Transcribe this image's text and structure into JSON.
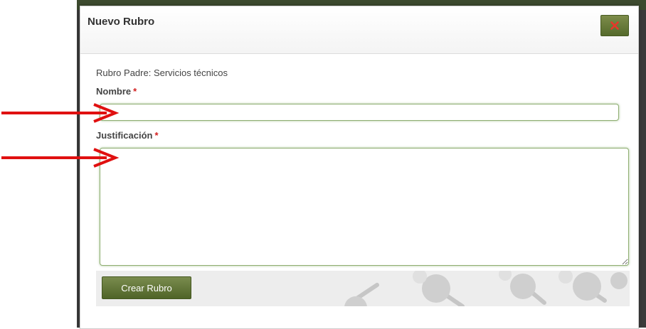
{
  "dialog": {
    "title": "Nuevo Rubro",
    "close_icon": "close-x-icon",
    "parent_label": "Rubro Padre:",
    "parent_value": "Servicios técnicos",
    "name_label": "Nombre",
    "name_value": "",
    "justification_label": "Justificación",
    "justification_value": "",
    "required_marker": "*",
    "submit_label": "Crear Rubro"
  },
  "colors": {
    "accent_green": "#5b6e2f",
    "required_red": "#d32020",
    "annotation_arrow": "#e01010"
  }
}
